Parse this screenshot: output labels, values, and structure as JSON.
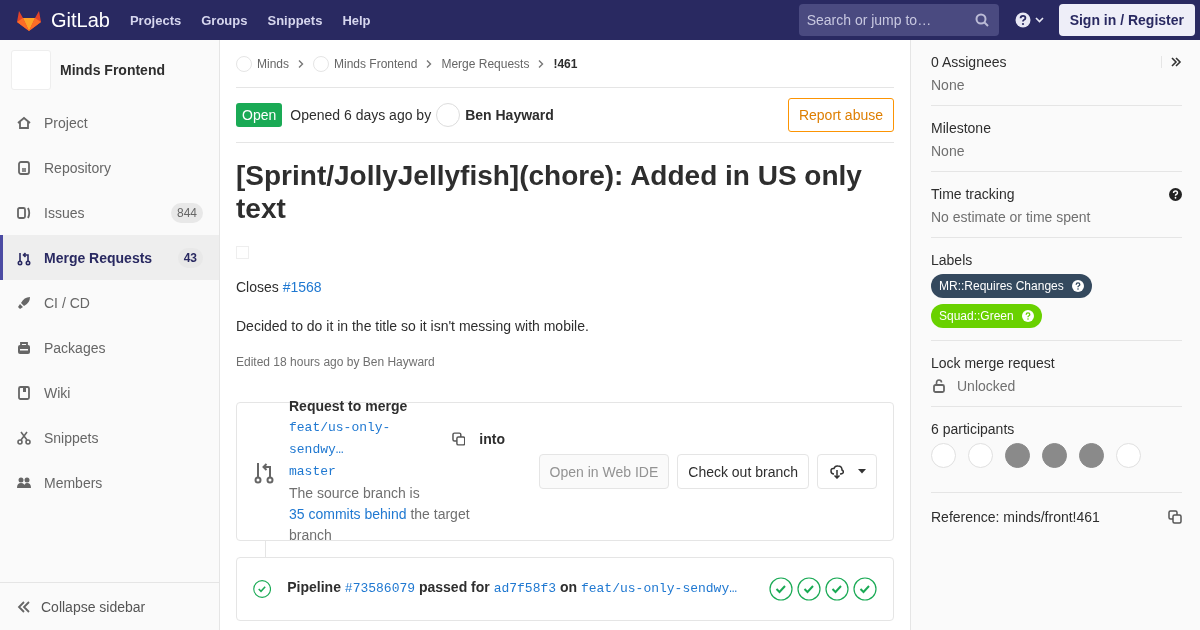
{
  "header": {
    "logo_text": "GitLab",
    "nav": [
      "Projects",
      "Groups",
      "Snippets",
      "Help"
    ],
    "search": {
      "placeholder": "Search or jump to…"
    },
    "sign_in": "Sign in / Register"
  },
  "sidebar": {
    "project_name": "Minds Frontend",
    "items": [
      {
        "label": "Project",
        "selected": false
      },
      {
        "label": "Repository",
        "selected": false
      },
      {
        "label": "Issues",
        "count": "844",
        "selected": false
      },
      {
        "label": "Merge Requests",
        "count": "43",
        "selected": true
      },
      {
        "label": "CI / CD",
        "selected": false
      },
      {
        "label": "Packages",
        "selected": false
      },
      {
        "label": "Wiki",
        "selected": false
      },
      {
        "label": "Snippets",
        "selected": false
      },
      {
        "label": "Members",
        "selected": false
      }
    ],
    "collapse": "Collapse sidebar"
  },
  "breadcrumbs": [
    {
      "label": "Minds",
      "kind": "avatar"
    },
    {
      "label": "Minds Frontend",
      "kind": "avatar"
    },
    {
      "label": "Merge Requests",
      "kind": "plain"
    },
    {
      "label": "!461",
      "kind": "current"
    }
  ],
  "issue": {
    "status": "Open",
    "opened": "Opened 6 days ago by",
    "author": "Ben Hayward",
    "report": "Report abuse",
    "title": "[Sprint/JollyJellyfish](chore): Added in US only text",
    "closes": {
      "text": "Closes",
      "link": "#1568"
    },
    "description": "Decided to do it in the title so it isn't messing with mobile.",
    "edited": "Edited 18 hours ago by Ben Hayward"
  },
  "merge": {
    "title": "Request to merge",
    "source": "feat/us-only-sendwy…",
    "into": "into",
    "target": "master",
    "behind_pre": "The source branch is",
    "behind_link": "35 commits behind",
    "behind_post": "the target branch",
    "buttons": [
      {
        "label": "Open in Web IDE",
        "disabled": true
      },
      {
        "label": "Check out branch",
        "disabled": false
      }
    ]
  },
  "pipeline": {
    "label": "Pipeline",
    "id": "#73586079",
    "passed_for": "passed for",
    "sha": "ad7f58f3",
    "on": "on",
    "branch": "feat/us-only-sendwy…",
    "stages": [
      {
        "passed": true
      },
      {
        "passed": true
      },
      {
        "passed": true
      },
      {
        "passed": true
      }
    ]
  },
  "right": {
    "assignees": {
      "title": "0 Assignees",
      "value": "None"
    },
    "milestone": {
      "title": "Milestone",
      "value": "None"
    },
    "time": {
      "title": "Time tracking",
      "value": "No estimate or time spent"
    },
    "labels": {
      "title": "Labels",
      "items": [
        {
          "text": "MR::Requires Changes",
          "color": "#34495e"
        },
        {
          "text": "Squad::Green",
          "color": "#69d100"
        }
      ]
    },
    "lock": {
      "title": "Lock merge request",
      "value": "Unlocked"
    },
    "participants": {
      "title": "6 participants",
      "avatars": [
        {
          "kind": "blank"
        },
        {
          "kind": "blank"
        },
        {
          "kind": "photo"
        },
        {
          "kind": "photo"
        },
        {
          "kind": "photo"
        },
        {
          "kind": "blank"
        }
      ]
    },
    "reference": "Reference: minds/front!461"
  }
}
